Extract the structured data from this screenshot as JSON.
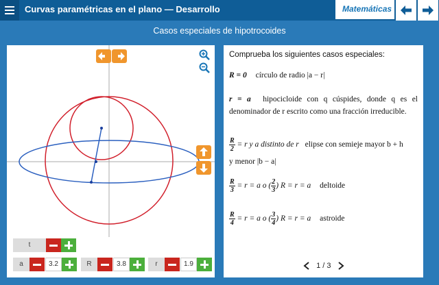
{
  "header": {
    "title": "Curvas paramétricas en el plano",
    "separator": "—",
    "section": "Desarrollo",
    "subject": "Matemáticas"
  },
  "subtitle": "Casos especiales de hipotrocoides",
  "controls": {
    "t": {
      "label": "t"
    },
    "a": {
      "label": "a",
      "value": "3.2"
    },
    "R": {
      "label": "R",
      "value": "3.8"
    },
    "r": {
      "label": "r",
      "value": "1.9"
    }
  },
  "right": {
    "intro": "Comprueba los siguientes casos especiales:",
    "case1_cond": "R = 0",
    "case1_text": "círculo de radio |a − r|",
    "case2_cond": "r = a",
    "case2_text": "hipocicloide con q cúspides, donde q es el denominador de r escrito como una fracción irreducible.",
    "case3_frac_num": "R",
    "case3_frac_den": "2",
    "case3_cond": "= r y a distinto de r",
    "case3_text": "elipse con semieje mayor b + h",
    "case3_text2": "y menor |b − a|",
    "case4_frac_num": "R",
    "case4_frac_den": "3",
    "case4_cond_a": "= r = a o (",
    "case4_frac2_num": "2",
    "case4_frac2_den": "3",
    "case4_cond_b": ") R = r = a",
    "case4_text": "deltoide",
    "case5_frac_num": "R",
    "case5_frac_den": "4",
    "case5_cond_a": "= r = a o (",
    "case5_frac2_num": "3",
    "case5_frac2_den": "4",
    "case5_cond_b": ") R = r = a",
    "case5_text": "astroide",
    "pager": "1 / 3"
  },
  "colors": {
    "topbar": "#0f5d97",
    "background": "#2a7ab8",
    "orange": "#f0962d",
    "red": "#c9261e",
    "green": "#4caf3c",
    "curve_red": "#d11f2b",
    "curve_blue": "#2a5fbf"
  },
  "icons": [
    "menu-icon",
    "arrow-left-icon",
    "arrow-right-icon",
    "zoom-in-icon",
    "zoom-out-icon",
    "arrow-up-icon",
    "arrow-down-icon",
    "minus-icon",
    "plus-icon",
    "chevron-left-icon",
    "chevron-right-icon"
  ]
}
